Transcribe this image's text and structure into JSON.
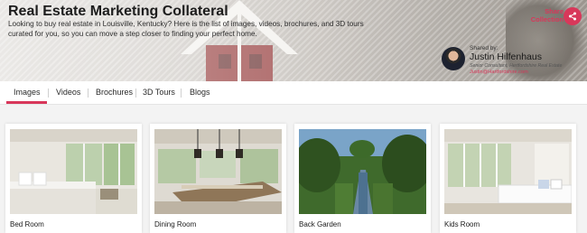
{
  "header": {
    "title": "Real Estate Marketing Collateral",
    "description": "Looking to buy real estate in Louisville, Kentucky? Here is the list of images, videos, brochures, and 3D tours curated for you, so you can move a step closer to finding your perfect home.",
    "share": {
      "label_line1": "Share",
      "label_line2": "Collection",
      "icon": "share-icon"
    }
  },
  "agent": {
    "shared_by": "Shared by:",
    "name": "Justin Hilfenhaus",
    "role": "Senior Consultant, Hertfordshire Real Estate",
    "email": "Justin@Hartfordshire.com"
  },
  "tabs": [
    {
      "label": "Images",
      "active": true
    },
    {
      "label": "Videos",
      "active": false
    },
    {
      "label": "Brochures",
      "active": false
    },
    {
      "label": "3D Tours",
      "active": false
    },
    {
      "label": "Blogs",
      "active": false
    }
  ],
  "gallery": [
    {
      "caption": "Bed Room"
    },
    {
      "caption": "Dining Room"
    },
    {
      "caption": "Back Garden"
    },
    {
      "caption": "Kids Room"
    }
  ],
  "colors": {
    "accent": "#d8375a",
    "text": "#1d1d1d",
    "background": "#f3f3f3"
  }
}
